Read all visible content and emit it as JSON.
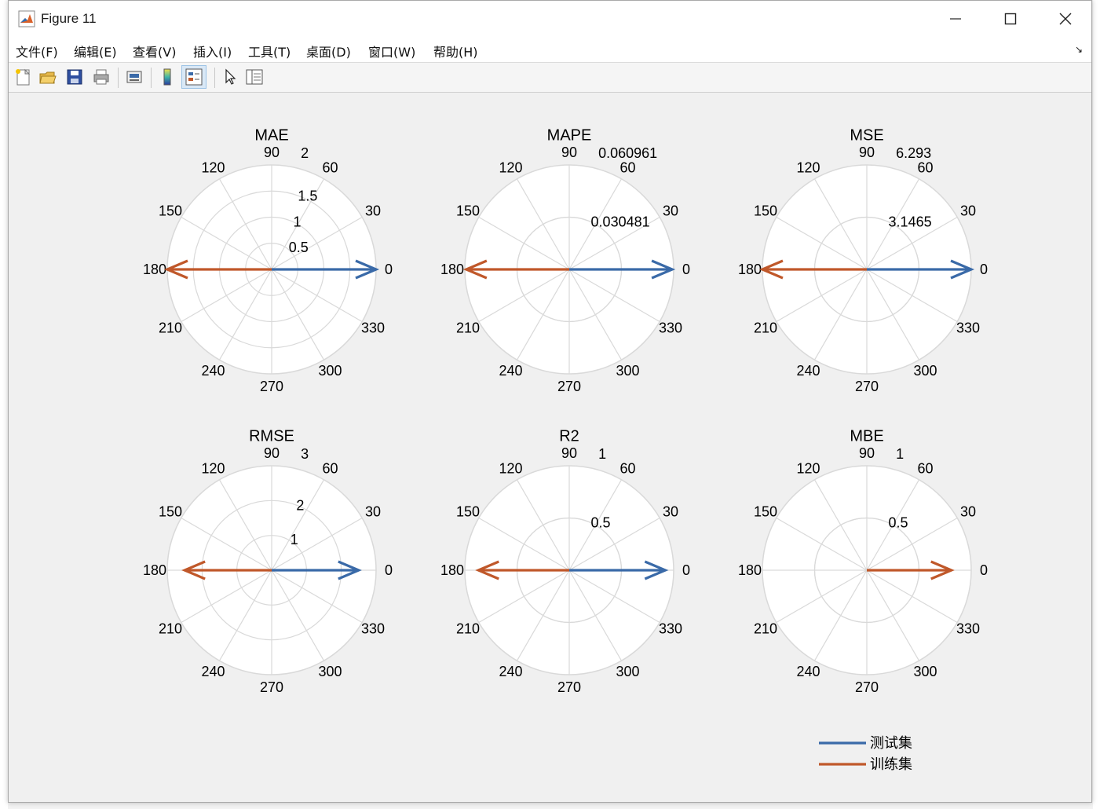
{
  "window": {
    "title": "Figure 11",
    "controls": [
      "minimize",
      "maximize",
      "close"
    ]
  },
  "menu": {
    "items": [
      "文件(F)",
      "编辑(E)",
      "查看(V)",
      "插入(I)",
      "工具(T)",
      "桌面(D)",
      "窗口(W)",
      "帮助(H)"
    ]
  },
  "toolbar": {
    "buttons": [
      {
        "name": "new-figure-icon"
      },
      {
        "name": "open-file-icon"
      },
      {
        "name": "save-icon"
      },
      {
        "name": "print-icon"
      },
      {
        "name": "link-plot-icon"
      },
      {
        "name": "colorbar-icon"
      },
      {
        "name": "legend-icon",
        "active": true
      },
      {
        "name": "pointer-icon"
      },
      {
        "name": "property-inspector-icon"
      }
    ]
  },
  "colors": {
    "test": "#3a6aa8",
    "train": "#c0582a",
    "grid": "#d9d9d9"
  },
  "chart_data": [
    {
      "type": "polar",
      "title": "MAE",
      "rticks": [
        "0.5",
        "1",
        "1.5",
        "2"
      ],
      "rmax": 2,
      "series": [
        {
          "name": "测试集",
          "angle_deg": 0,
          "magnitude": 2
        },
        {
          "name": "训练集",
          "angle_deg": 180,
          "magnitude": 2
        }
      ]
    },
    {
      "type": "polar",
      "title": "MAPE",
      "rticks": [
        "0.030481",
        "0.060961"
      ],
      "rmax": 0.060961,
      "series": [
        {
          "name": "测试集",
          "angle_deg": 0,
          "magnitude": 0.0601
        },
        {
          "name": "训练集",
          "angle_deg": 180,
          "magnitude": 0.0601
        }
      ]
    },
    {
      "type": "polar",
      "title": "MSE",
      "rticks": [
        "3.1465",
        "6.293"
      ],
      "rmax": 6.293,
      "series": [
        {
          "name": "测试集",
          "angle_deg": 0,
          "magnitude": 6.293
        },
        {
          "name": "训练集",
          "angle_deg": 180,
          "magnitude": 6.293
        }
      ]
    },
    {
      "type": "polar",
      "title": "RMSE",
      "rticks": [
        "1",
        "2",
        "3"
      ],
      "rmax": 3,
      "series": [
        {
          "name": "测试集",
          "angle_deg": 0,
          "magnitude": 2.5
        },
        {
          "name": "训练集",
          "angle_deg": 180,
          "magnitude": 2.5
        }
      ]
    },
    {
      "type": "polar",
      "title": "R2",
      "rticks": [
        "0.5",
        "1"
      ],
      "rmax": 1,
      "series": [
        {
          "name": "测试集",
          "angle_deg": 0,
          "magnitude": 0.92
        },
        {
          "name": "训练集",
          "angle_deg": 180,
          "magnitude": 0.87
        }
      ]
    },
    {
      "type": "polar",
      "title": "MBE",
      "rticks": [
        "0.5",
        "1"
      ],
      "rmax": 1,
      "series": [
        {
          "name": "测试集",
          "angle_deg": 0,
          "magnitude": 0
        },
        {
          "name": "训练集",
          "angle_deg": 0,
          "magnitude": 0.81
        }
      ]
    }
  ],
  "angle_ticks": [
    "0",
    "30",
    "60",
    "90",
    "120",
    "150",
    "180",
    "210",
    "240",
    "270",
    "300",
    "330"
  ],
  "legend": {
    "entries": [
      {
        "label": "测试集",
        "color_key": "test"
      },
      {
        "label": "训练集",
        "color_key": "train"
      }
    ],
    "placement": "bottom-right"
  }
}
